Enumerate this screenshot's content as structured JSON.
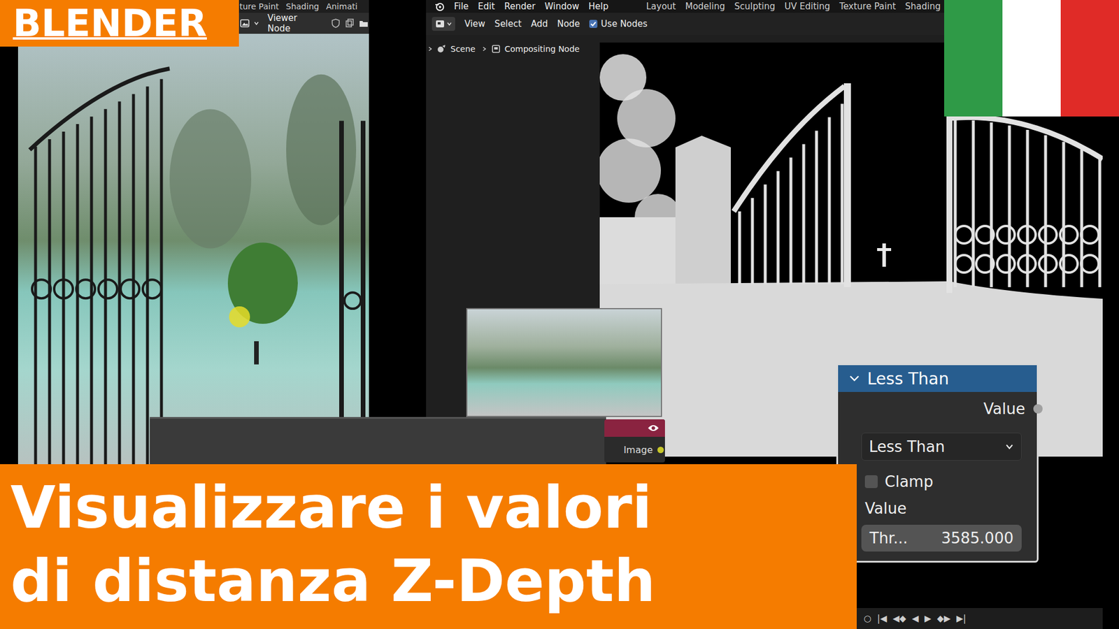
{
  "badge": "BLENDER",
  "left_window": {
    "tabs": [
      "ture Paint",
      "Shading",
      "Animati"
    ],
    "header": {
      "label": "Viewer Node"
    }
  },
  "right_window": {
    "menu": [
      "File",
      "Edit",
      "Render",
      "Window",
      "Help"
    ],
    "workspaces": [
      "Layout",
      "Modeling",
      "Sculpting",
      "UV Editing",
      "Texture Paint",
      "Shading"
    ],
    "toolbar": [
      "View",
      "Select",
      "Add",
      "Node"
    ],
    "use_nodes": {
      "label": "Use Nodes",
      "checked": true
    },
    "breadcrumb": [
      "Scene",
      "Compositing Node"
    ]
  },
  "viewer_node": {
    "socket": "Image"
  },
  "less_than_node": {
    "title": "Less Than",
    "expanded": true,
    "output": "Value",
    "operation": "Less Than",
    "clamp": {
      "label": "Clamp",
      "checked": false
    },
    "inputs_label": "Value",
    "threshold": {
      "label": "Thr...",
      "value": "3585.000"
    }
  },
  "timeline": [
    "○",
    "|◀",
    "◀◆",
    "◀",
    "▶",
    "◆▶",
    "▶|"
  ],
  "title": [
    "Visualizzare i valori",
    "di distanza Z-Depth"
  ]
}
